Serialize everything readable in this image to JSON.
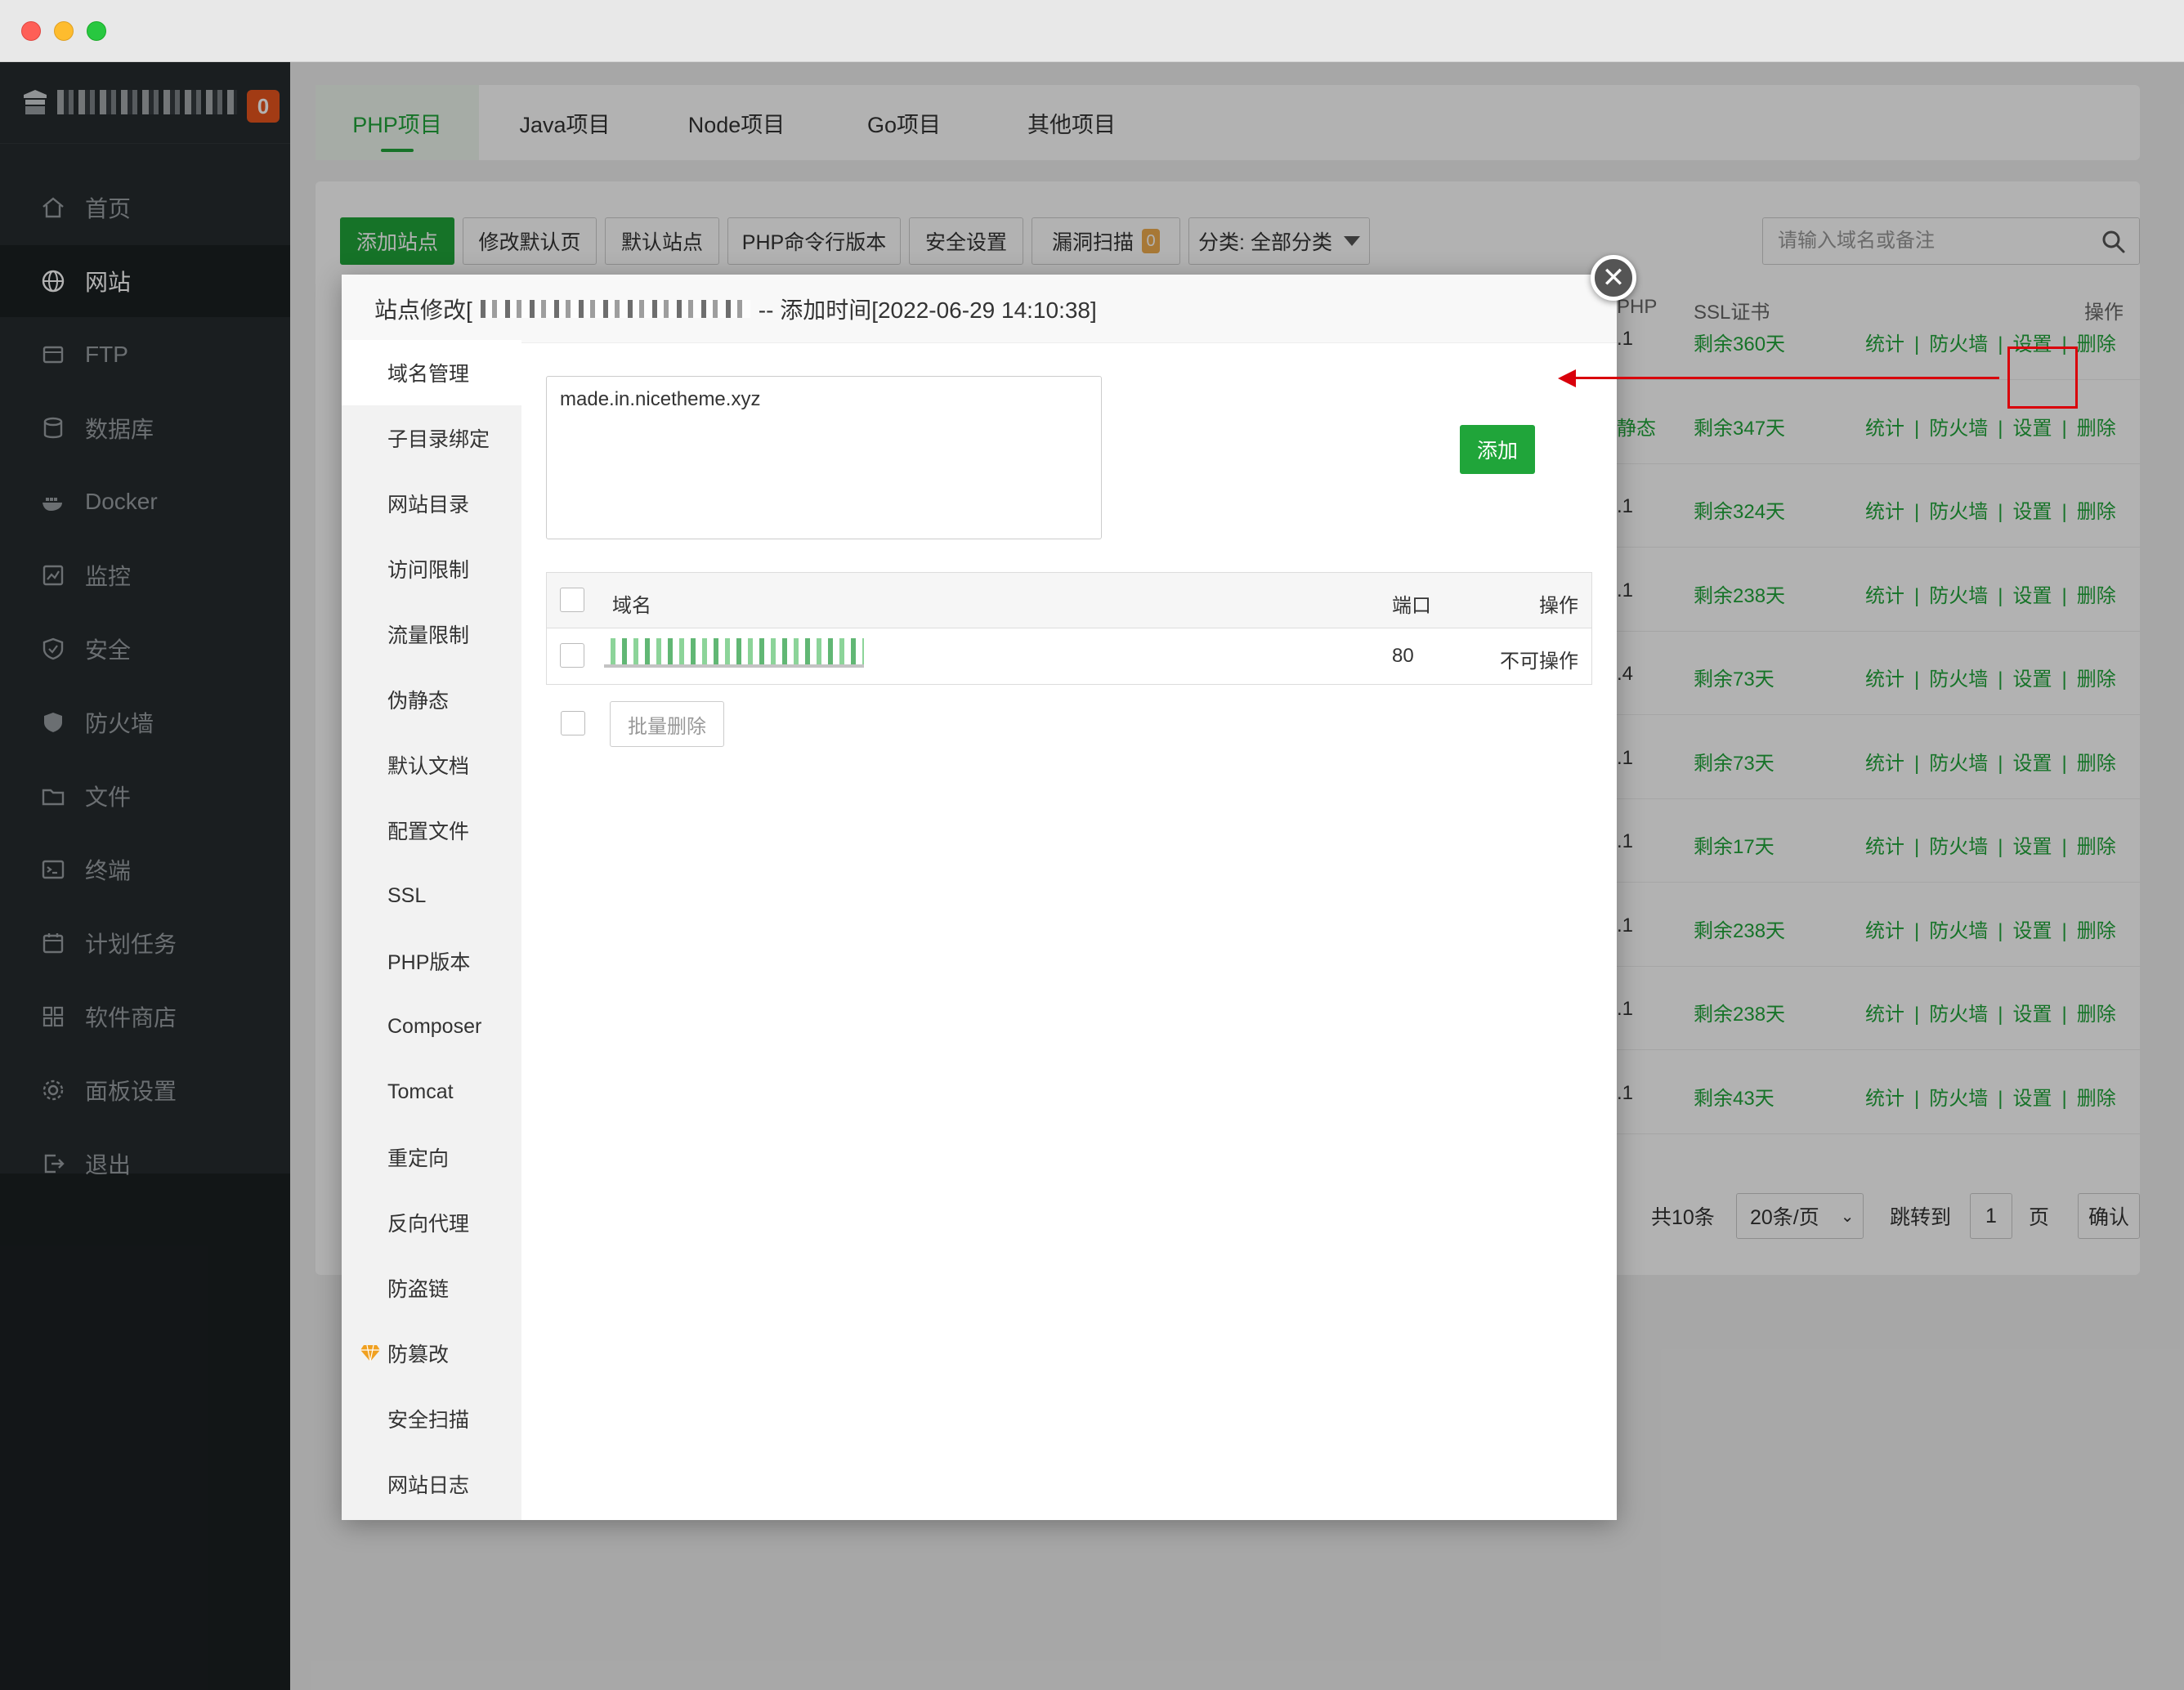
{
  "sidebar": {
    "server_badge": "0",
    "items": [
      {
        "label": "首页",
        "icon": "home-icon"
      },
      {
        "label": "网站",
        "icon": "globe-icon"
      },
      {
        "label": "FTP",
        "icon": "ftp-icon"
      },
      {
        "label": "数据库",
        "icon": "database-icon"
      },
      {
        "label": "Docker",
        "icon": "docker-icon"
      },
      {
        "label": "监控",
        "icon": "monitor-icon"
      },
      {
        "label": "安全",
        "icon": "shield-icon"
      },
      {
        "label": "防火墙",
        "icon": "firewall-icon"
      },
      {
        "label": "文件",
        "icon": "folder-icon"
      },
      {
        "label": "终端",
        "icon": "terminal-icon"
      },
      {
        "label": "计划任务",
        "icon": "calendar-icon"
      },
      {
        "label": "软件商店",
        "icon": "apps-icon"
      },
      {
        "label": "面板设置",
        "icon": "gear-icon"
      },
      {
        "label": "退出",
        "icon": "logout-icon"
      }
    ]
  },
  "tabs": [
    "PHP项目",
    "Java项目",
    "Node项目",
    "Go项目",
    "其他项目"
  ],
  "toolbar": {
    "add_site": "添加站点",
    "edit_default_page": "修改默认页",
    "default_site": "默认站点",
    "php_cli_version": "PHP命令行版本",
    "security_settings": "安全设置",
    "vuln_scan": "漏洞扫描",
    "vuln_count": "0",
    "category": "分类: 全部分类",
    "search_placeholder": "请输入域名或备注"
  },
  "table": {
    "headers": {
      "php": "PHP",
      "ssl": "SSL证书",
      "ops": "操作"
    },
    "rows": [
      {
        "php": ".1",
        "ssl": "剩余360天"
      },
      {
        "php": "静态",
        "ssl": "剩余347天"
      },
      {
        "php": ".1",
        "ssl": "剩余324天"
      },
      {
        "php": ".1",
        "ssl": "剩余238天"
      },
      {
        "php": ".4",
        "ssl": "剩余73天"
      },
      {
        "php": ".1",
        "ssl": "剩余73天"
      },
      {
        "php": ".1",
        "ssl": "剩余17天"
      },
      {
        "php": ".1",
        "ssl": "剩余238天"
      },
      {
        "php": ".1",
        "ssl": "剩余238天"
      },
      {
        "php": ".1",
        "ssl": "剩余43天"
      }
    ],
    "ops": {
      "stats": "统计",
      "firewall": "防火墙",
      "settings": "设置",
      "delete": "删除",
      "divider": "|"
    }
  },
  "pager": {
    "total": "共10条",
    "per_page": "20条/页",
    "jump_to": "跳转到",
    "page_value": "1",
    "page_unit": "页",
    "confirm": "确认"
  },
  "modal": {
    "title_prefix": "站点修改[",
    "title_suffix": " -- 添加时间[2022-06-29 14:10:38]",
    "close_glyph": "✕",
    "nav": [
      "域名管理",
      "子目录绑定",
      "网站目录",
      "访问限制",
      "流量限制",
      "伪静态",
      "默认文档",
      "配置文件",
      "SSL",
      "PHP版本",
      "Composer",
      "Tomcat",
      "重定向",
      "反向代理",
      "防盗链",
      "防篡改",
      "安全扫描",
      "网站日志"
    ],
    "domain_input": "made.in.nicetheme.xyz",
    "add_button": "添加",
    "domain_table": {
      "col_domain": "域名",
      "col_port": "端口",
      "col_ops": "操作",
      "row_port": "80",
      "row_ops": "不可操作"
    },
    "batch_delete": "批量删除"
  },
  "colors": {
    "accent": "#20a53a",
    "sidebar_bg": "#262b2e",
    "badge": "#e8551e",
    "annotation": "#d9000b"
  }
}
